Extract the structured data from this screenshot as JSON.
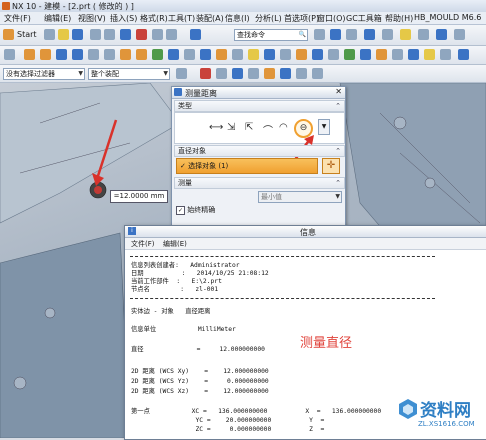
{
  "window": {
    "title": "NX 10 - 建模 - [2.prt  ( 修改的 ) ]"
  },
  "menubar": {
    "items": [
      "文件(F)",
      "编辑(E)",
      "视图(V)",
      "插入(S)",
      "格式(R)",
      "工具(T)",
      "装配(A)",
      "信息(I)",
      "分析(L)",
      "首选项(P)",
      "窗口(O)",
      "GC工具箱",
      "帮助(H)",
      "HB_MOULD M6.6"
    ]
  },
  "toolbar": {
    "start_label": "Start",
    "search_placeholder": "查找命令"
  },
  "filters": {
    "selection_filter": "没有选择过滤器",
    "assembly_scope": "整个装配"
  },
  "measure_dialog": {
    "title": "测量距离",
    "type_section": "类型",
    "radius_section": "直径对象",
    "select_object": "选择对象 (1)",
    "measure_section": "测量",
    "min_value": "最小值",
    "always_precise": "始终精确",
    "always_precise_checked": true
  },
  "measure_label": "=12.0000 mm",
  "info_window": {
    "title": "信息",
    "menu": [
      "文件(F)",
      "编辑(E)"
    ],
    "lines": [
      "信息列表创建者:   Administrator",
      "日期          :   2014/10/25 21:08:12",
      "当前工作部件  :   E:\\2.prt",
      "节点名        :   zl-001",
      "实体边 - 对象   直径距离",
      "信息单位           MilliMeter",
      "直径              =     12.000000000",
      "2D 距离 (WCS Xy)    =    12.000000000",
      "2D 距离 (WCS Yz)    =     0.000000000",
      "2D 距离 (WCS Xz)    =    12.000000000",
      "第一点           XC =   136.000000000          X  =   136.000000000",
      "                 YC =    20.000000000          Y  =",
      "                 ZC =     0.000000000          Z  ="
    ],
    "annotation": "测量直径"
  },
  "watermark": {
    "brand": "资料网",
    "url": "ZL.XS1616.COM"
  },
  "colors": {
    "accent_orange": "#f0a030",
    "arrow_red": "#d9322b",
    "annotation_red": "#e0443c"
  }
}
